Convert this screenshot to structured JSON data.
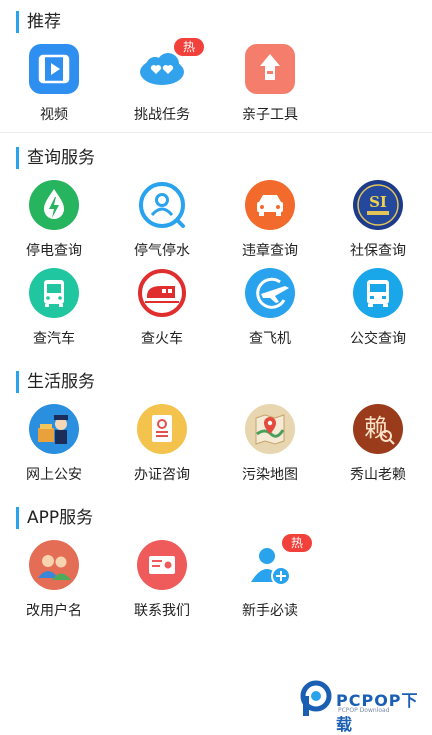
{
  "sections": [
    {
      "title": "推荐",
      "items": [
        {
          "label": "视频",
          "icon": "video-icon"
        },
        {
          "label": "挑战任务",
          "icon": "cloud-hearts-icon",
          "badge": "热"
        },
        {
          "label": "亲子工具",
          "icon": "house-arrow-icon"
        }
      ]
    },
    {
      "title": "查询服务",
      "items": [
        {
          "label": "停电查询",
          "icon": "lightning-drop-icon"
        },
        {
          "label": "停气停水",
          "icon": "person-search-icon"
        },
        {
          "label": "违章查询",
          "icon": "car-icon"
        },
        {
          "label": "社保查询",
          "icon": "social-security-icon"
        },
        {
          "label": "查汽车",
          "icon": "bus-icon"
        },
        {
          "label": "查火车",
          "icon": "train-icon"
        },
        {
          "label": "查飞机",
          "icon": "airplane-icon"
        },
        {
          "label": "公交查询",
          "icon": "bus-front-icon"
        }
      ]
    },
    {
      "title": "生活服务",
      "items": [
        {
          "label": "网上公安",
          "icon": "police-icon"
        },
        {
          "label": "办证咨询",
          "icon": "certificate-icon"
        },
        {
          "label": "污染地图",
          "icon": "map-pin-icon"
        },
        {
          "label": "秀山老赖",
          "icon": "debtor-search-icon"
        }
      ]
    },
    {
      "title": "APP服务",
      "items": [
        {
          "label": "改用户名",
          "icon": "users-icon"
        },
        {
          "label": "联系我们",
          "icon": "contact-card-icon"
        },
        {
          "label": "新手必读",
          "icon": "add-user-icon",
          "badge": "热"
        }
      ]
    }
  ],
  "social_security_badge": "SI",
  "debtor_glyph": "赖",
  "watermark": {
    "brand": "PCPOP下载",
    "sub": "PCPOP Download"
  },
  "colors": {
    "accent": "#2aa3ef",
    "badge": "#f2403a"
  }
}
